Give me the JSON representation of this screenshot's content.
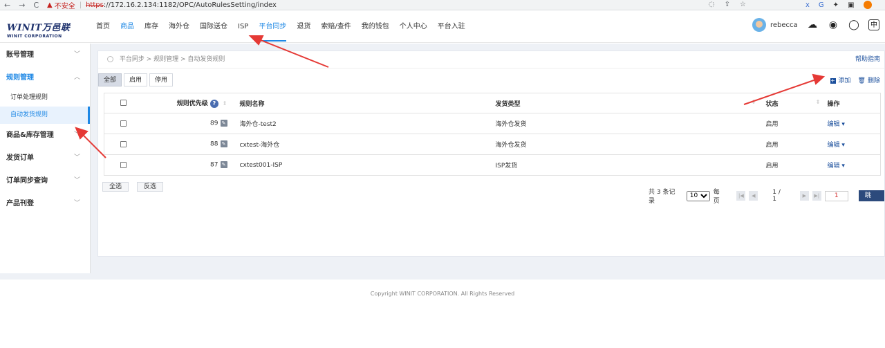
{
  "browser": {
    "back": "←",
    "forward": "→",
    "reload": "C",
    "not_secure": "不安全",
    "scheme": "https",
    "url_rest": "://172.16.2.134:1182/OPC/AutoRulesSetting/index",
    "profile_initial": "G"
  },
  "brand": {
    "name": "WINIT万邑联",
    "sub": "WINIT CORPORATION"
  },
  "nav": {
    "items": [
      {
        "label": "首页",
        "active": false
      },
      {
        "label": "商品",
        "active": true
      },
      {
        "label": "库存",
        "active": false
      },
      {
        "label": "海外仓",
        "active": false
      },
      {
        "label": "国际送仓",
        "active": false
      },
      {
        "label": "ISP",
        "active": false
      },
      {
        "label": "平台同步",
        "active": true
      },
      {
        "label": "退货",
        "active": false
      },
      {
        "label": "索赔/查件",
        "active": false
      },
      {
        "label": "我的钱包",
        "active": false
      },
      {
        "label": "个人中心",
        "active": false
      },
      {
        "label": "平台入驻",
        "active": false
      }
    ],
    "user": "rebecca",
    "lang": "中"
  },
  "sidebar": {
    "groups": [
      {
        "label": "账号管理",
        "chevron": "﹀"
      },
      {
        "label": "规则管理",
        "chevron": "︿",
        "open": true,
        "children": [
          {
            "label": "订单处理规则",
            "selected": false
          },
          {
            "label": "自动发货规则",
            "selected": true
          }
        ]
      },
      {
        "label": "商品&库存管理",
        "chevron": "﹀"
      },
      {
        "label": "发货订单",
        "chevron": "﹀"
      },
      {
        "label": "订单同步查询",
        "chevron": "﹀"
      },
      {
        "label": "产品刊登",
        "chevron": "﹀"
      }
    ]
  },
  "breadcrumb": "平台同步 > 规则管理 > 自动发货规则",
  "help": "帮助指南",
  "tabs": [
    "全部",
    "启用",
    "停用"
  ],
  "actions": {
    "add": "添加",
    "delete": "删除"
  },
  "table": {
    "headers": {
      "priority": "规则优先级",
      "name": "规则名称",
      "type": "发货类型",
      "status": "状态",
      "ops": "操作"
    },
    "rows": [
      {
        "priority": "89",
        "name": "海外仓-test2",
        "type": "海外仓发货",
        "status": "启用",
        "op": "编辑"
      },
      {
        "priority": "88",
        "name": "cxtest-海外仓",
        "type": "海外仓发货",
        "status": "启用",
        "op": "编辑"
      },
      {
        "priority": "87",
        "name": "cxtest001-ISP",
        "type": "ISP发货",
        "status": "启用",
        "op": "编辑"
      }
    ]
  },
  "bulk": {
    "select_all": "全选",
    "invert": "反选"
  },
  "pager": {
    "total": "共 3 条记录",
    "page_size": "10",
    "per_page": "每页",
    "pages": "1 / 1",
    "page_input": "1",
    "go": "跳 转"
  },
  "footer": "Copyright WINIT CORPORATION. All Rights Reserved",
  "colors": {
    "accent": "#1e88e5",
    "navy": "#2c4a7c",
    "annotation": "#e53935"
  }
}
